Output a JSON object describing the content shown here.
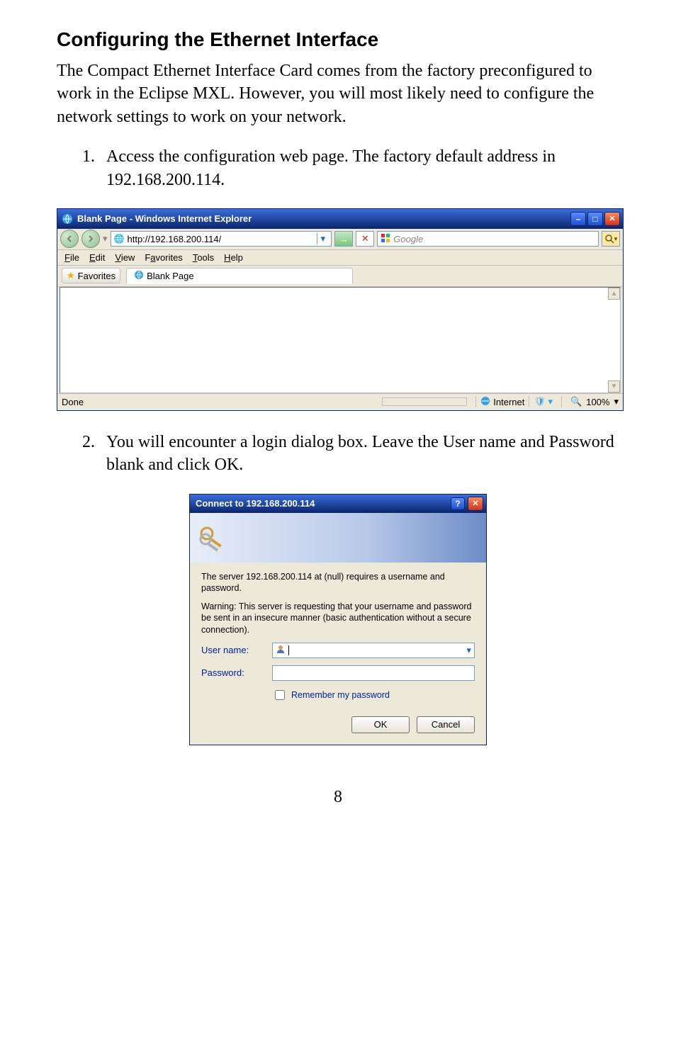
{
  "heading": "Configuring the Ethernet Interface",
  "intro": "The Compact Ethernet Interface Card comes from the factory preconfigured to work in the Eclipse MXL.  However, you will most likely need to configure the network settings to work on your network.",
  "steps": {
    "one": "Access the configuration web page.  The factory default address in 192.168.200.114.",
    "two": "You will encounter a login dialog box.  Leave the User name and Password blank and click OK."
  },
  "ie": {
    "title": "Blank Page - Windows Internet Explorer",
    "url": "http://192.168.200.114/",
    "search_placeholder": "Google",
    "menus": {
      "file": "File",
      "edit": "Edit",
      "view": "View",
      "favorites": "Favorites",
      "tools": "Tools",
      "help": "Help"
    },
    "favorites_btn": "Favorites",
    "tab_label": "Blank Page",
    "status_left": "Done",
    "status_zone": "Internet",
    "status_zoom": "100%"
  },
  "login": {
    "title": "Connect to 192.168.200.114",
    "msg1": "The server 192.168.200.114 at (null) requires a username and password.",
    "msg2": "Warning: This server is requesting that your username and password be sent in an insecure manner (basic authentication without a secure connection).",
    "user_label": "User name:",
    "pass_label": "Password:",
    "remember": "Remember my password",
    "ok": "OK",
    "cancel": "Cancel"
  },
  "page_number": "8"
}
